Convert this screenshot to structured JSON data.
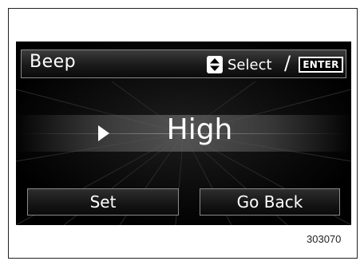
{
  "header": {
    "title": "Beep",
    "select_label": "Select",
    "separator": "/",
    "enter_label": "ENTER",
    "select_icon": "up-down-arrows-icon"
  },
  "value": {
    "text": "High",
    "pointer_icon": "right-triangle-pointer-icon"
  },
  "buttons": {
    "set_label": "Set",
    "back_label": "Go Back"
  },
  "figure": {
    "number": "303070"
  },
  "colors": {
    "screen_background": "#000000",
    "text": "#ffffff",
    "border": "#8a8a8a"
  }
}
